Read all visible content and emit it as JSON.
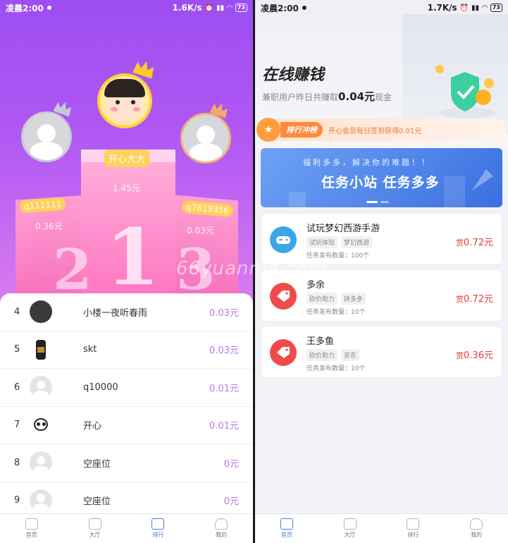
{
  "left": {
    "status": {
      "time": "凌晨2:00",
      "speed": "1.6K/s",
      "battery": "73"
    },
    "podium": {
      "first": {
        "name": "开心大大",
        "amount": "1.45元"
      },
      "second": {
        "name": "q111111",
        "amount": "0.36元"
      },
      "third": {
        "name": "q7619356",
        "amount": "0.03元"
      }
    },
    "rank_rows": [
      {
        "rank": "4",
        "name": "小楼一夜听春雨",
        "value": "0.03元",
        "avatar": "photo"
      },
      {
        "rank": "5",
        "name": "skt",
        "value": "0.03元",
        "avatar": "bottle"
      },
      {
        "rank": "6",
        "name": "q10000",
        "value": "0.01元",
        "avatar": "default"
      },
      {
        "rank": "7",
        "name": "开心",
        "value": "0.01元",
        "avatar": "panda"
      },
      {
        "rank": "8",
        "name": "空座位",
        "value": "0元",
        "avatar": "default"
      },
      {
        "rank": "9",
        "name": "空座位",
        "value": "0元",
        "avatar": "default"
      }
    ],
    "tabs": [
      {
        "label": "首页",
        "icon": "home-icon",
        "active": false
      },
      {
        "label": "大厅",
        "icon": "hall-icon",
        "active": false
      },
      {
        "label": "排行",
        "icon": "ranking-icon",
        "active": true
      },
      {
        "label": "我的",
        "icon": "profile-icon",
        "active": false
      }
    ]
  },
  "right": {
    "status": {
      "time": "凌晨2:00",
      "speed": "1.7K/s",
      "battery": "73"
    },
    "title": "在线赚钱",
    "subtitle_prefix": "兼职用户昨日共赚取",
    "subtitle_amount": "0.04元",
    "subtitle_suffix": "现金",
    "notice": {
      "tag": "排行冲榜",
      "message": "开心会员每日签到获得0.01元"
    },
    "banner": {
      "slogan": "福利多多，解决你的难题！！",
      "headline": "任务小站  任务多多"
    },
    "tasks": [
      {
        "name": "试玩梦幻西游手游",
        "tags": [
          "试玩体验",
          "梦幻西游"
        ],
        "count": "任务发布数量：100个",
        "reward_prefix": "赏",
        "reward": "0.72元",
        "icon": "gamepad-icon",
        "color": "#3aa6e8"
      },
      {
        "name": "多余",
        "tags": [
          "砍价助力",
          "拼多多"
        ],
        "count": "任务发布数量：10个",
        "reward_prefix": "赏",
        "reward": "0.72元",
        "icon": "tag-icon",
        "color": "#ef4b4b"
      },
      {
        "name": "王多鱼",
        "tags": [
          "砍价助力",
          "京东"
        ],
        "count": "任务发布数量：10个",
        "reward_prefix": "赏",
        "reward": "0.36元",
        "icon": "tag-icon",
        "color": "#ef4b4b"
      }
    ],
    "tabs": [
      {
        "label": "首页",
        "icon": "home-icon",
        "active": true
      },
      {
        "label": "大厅",
        "icon": "hall-icon",
        "active": false
      },
      {
        "label": "排行",
        "icon": "ranking-icon",
        "active": false
      },
      {
        "label": "我的",
        "icon": "profile-icon",
        "active": false
      }
    ]
  },
  "watermark": "66yuanma.com"
}
